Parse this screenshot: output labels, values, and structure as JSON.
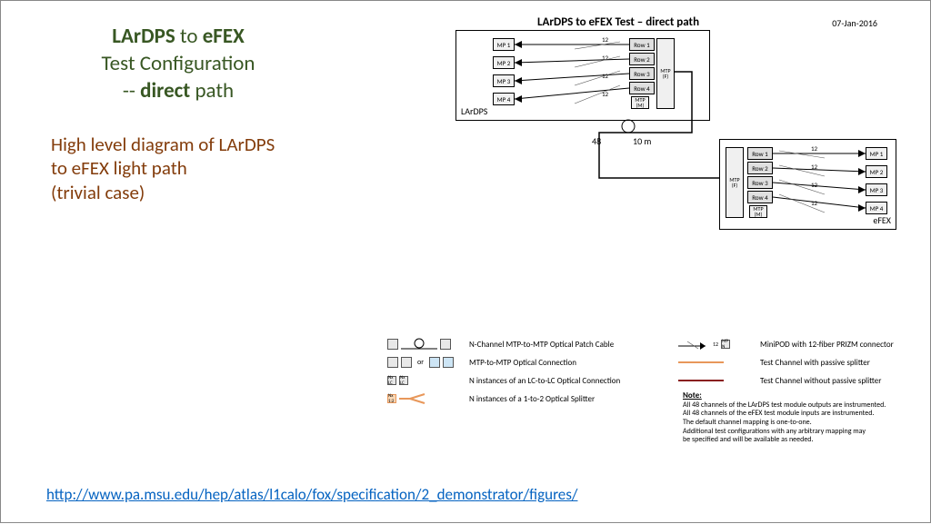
{
  "title": {
    "part1a": "LArDPS",
    "part1b": " to ",
    "part1c": "eFEX",
    "line2": "Test Configuration",
    "line3a": "-- ",
    "line3b": "direct",
    "line3c": " path"
  },
  "description": "High level diagram of LArDPS to eFEX light path\n(trivial case)",
  "diagram": {
    "title": "LArDPS to eFEX Test – direct path",
    "date": "07-Jan-2016",
    "lardps": {
      "label": "LArDPS",
      "mp": [
        "MP 1",
        "MP 2",
        "MP 3",
        "MP 4"
      ],
      "rows": [
        "Row 1",
        "Row 2",
        "Row 3",
        "Row 4"
      ],
      "mtp_m": "MTP (M)",
      "mtp_f": "MTP (F)",
      "fiber_count": "12"
    },
    "efex": {
      "label": "eFEX",
      "mp": [
        "MP 1",
        "MP 2",
        "MP 3",
        "MP 4"
      ],
      "rows": [
        "Row 1",
        "Row 2",
        "Row 3",
        "Row 4"
      ],
      "mtp_m": "MTP (M)",
      "mtp_f": "MTP (F)",
      "fiber_count": "12"
    },
    "cable": {
      "count": "48",
      "length": "10 m"
    }
  },
  "legend": {
    "left": [
      "N-Channel MTP-to-MTP Optical Patch Cable",
      "MTP-to-MTP Optical Connection",
      "N instances of  an LC-to-LC Optical Connection",
      "N instances of  a 1-to-2 Optical Splitter"
    ],
    "right": [
      "MiniPOD with 12-fiber PRIZM connector",
      "Test Channel with passive splitter",
      "Test Channel without passive splitter"
    ],
    "right_sym": {
      "fiber": "12",
      "mpn": "MP N"
    },
    "or": "or",
    "nx": "Nx LC",
    "nx12": "Nx 1:2"
  },
  "note": {
    "heading": "Note:",
    "lines": [
      "All 48 channels of the LArDPS test module outputs are instrumented.",
      "All 48 channels of the eFEX test module inputs are instrumented.",
      "The default channel mapping is one-to-one.",
      "Additional test configurations with any arbitrary mapping may",
      "be specified and will be available as needed."
    ]
  },
  "footer_link": "http://www.pa.msu.edu/hep/atlas/l1calo/fox/specification/2_demonstrator/figures/"
}
